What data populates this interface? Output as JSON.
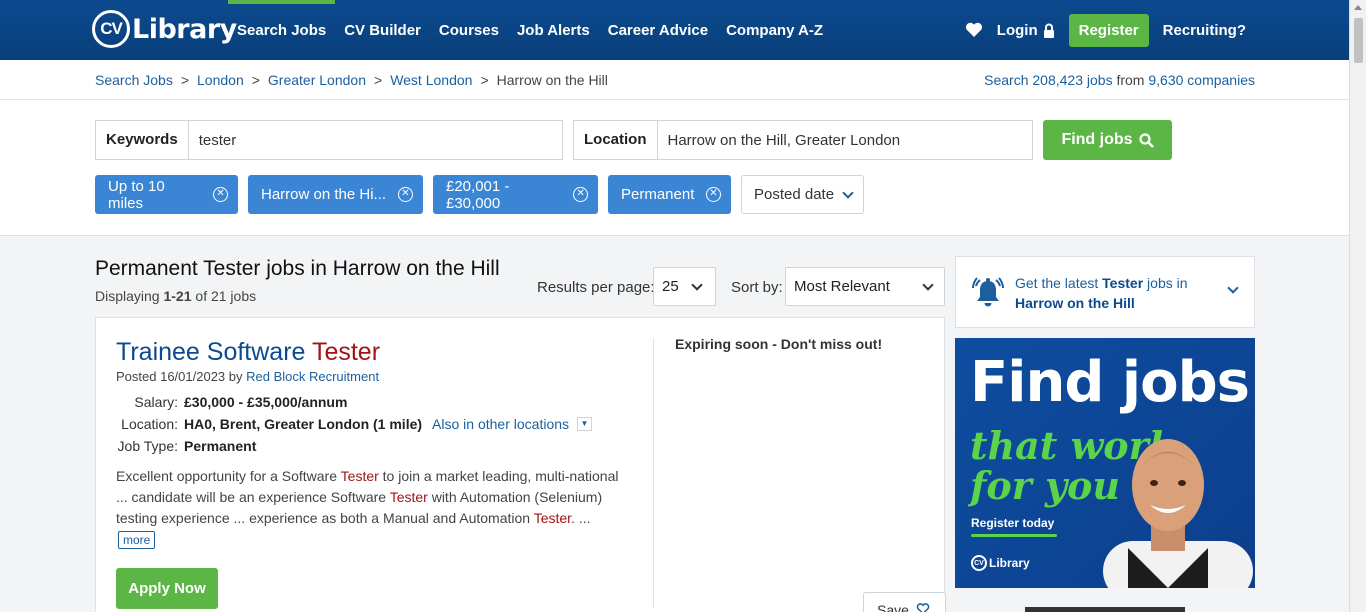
{
  "header": {
    "logo_cv": "CV",
    "logo_text": "Library",
    "nav": [
      "Search Jobs",
      "CV Builder",
      "Courses",
      "Job Alerts",
      "Career Advice",
      "Company A-Z"
    ],
    "login": "Login",
    "register": "Register",
    "recruiting": "Recruiting?"
  },
  "breadcrumb": [
    "Search Jobs",
    "London",
    "Greater London",
    "West London",
    "Harrow on the Hill"
  ],
  "stats": {
    "prefix": "Search",
    "jobs": "208,423 jobs",
    "from": "from",
    "companies": "9,630 companies"
  },
  "search": {
    "keywords_label": "Keywords",
    "keywords_value": "tester",
    "location_label": "Location",
    "location_value": "Harrow on the Hill, Greater London",
    "find_label": "Find jobs"
  },
  "filters": [
    "Up to 10 miles",
    "Harrow on the Hi...",
    "£20,001 - £30,000",
    "Permanent"
  ],
  "posted_date": "Posted date",
  "results": {
    "title": "Permanent Tester jobs in Harrow on the Hill",
    "displaying_prefix": "Displaying",
    "displaying_range": "1-21",
    "displaying_suffix": "of 21 jobs",
    "rpp_label": "Results per page:",
    "rpp_value": "25",
    "sort_label": "Sort by:",
    "sort_value": "Most Relevant"
  },
  "job": {
    "title_prefix": "Trainee Software",
    "title_highlight": "Tester",
    "posted": "Posted 16/01/2023 by",
    "company": "Red Block Recruitment",
    "salary_label": "Salary:",
    "salary": "£30,000 - £35,000/annum",
    "location_label": "Location:",
    "location": "HA0, Brent, Greater London (1 mile)",
    "also": "Also in other locations",
    "type_label": "Job Type:",
    "type": "Permanent",
    "desc_1": "Excellent opportunity for a Software",
    "desc_hl1": "Tester",
    "desc_2": "to join a market leading, multi-national ... candidate will be an experience Software",
    "desc_hl2": "Tester",
    "desc_3": "with Automation (Selenium) testing experience ... experience as both a Manual and Automation",
    "desc_hl3": "Tester",
    "desc_4": ". ...",
    "more": "more",
    "apply": "Apply Now",
    "expiring": "Expiring soon - Don't miss out!",
    "save": "Save"
  },
  "alert": {
    "prefix": "Get the latest",
    "keyword": "Tester",
    "middle": "jobs in",
    "place": "Harrow on the Hill"
  },
  "ad": {
    "title": "Find jobs",
    "script_1": "that work",
    "script_2": "for you",
    "register": "Register today",
    "logo_cv": "CV",
    "logo_text": "Library"
  },
  "colors": {
    "brand_blue": "#0b4a8f",
    "green": "#5bb645",
    "chip_blue": "#3a86d4",
    "highlight_red": "#a31414"
  }
}
